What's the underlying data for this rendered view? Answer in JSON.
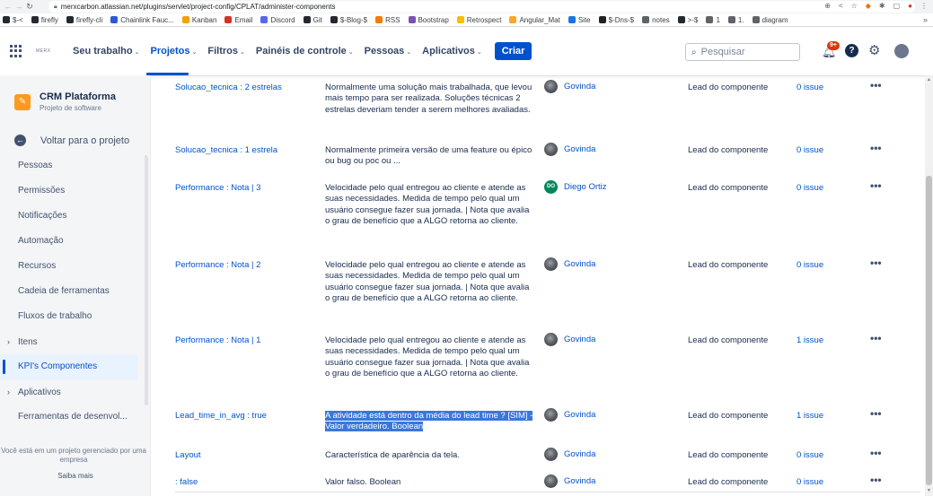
{
  "browser": {
    "url": "merxcarbon.atlassian.net/plugins/servlet/project-config/CPLAT/administer-components",
    "bookmarks": [
      {
        "label": "$-<",
        "icon": "github-icon",
        "color": "#24292f"
      },
      {
        "label": "firefly",
        "icon": "github-icon",
        "color": "#24292f"
      },
      {
        "label": "firefly-cli",
        "icon": "github-icon",
        "color": "#24292f"
      },
      {
        "label": "Chainlink Fauc...",
        "icon": "chainlink-icon",
        "color": "#2a5ada"
      },
      {
        "label": "Kanban",
        "icon": "kanban-icon",
        "color": "#f2a100"
      },
      {
        "label": "Email",
        "icon": "gmail-icon",
        "color": "#d93025"
      },
      {
        "label": "Discord",
        "icon": "discord-icon",
        "color": "#5865f2"
      },
      {
        "label": "Git",
        "icon": "github-icon",
        "color": "#24292f"
      },
      {
        "label": "$-Blog-$",
        "icon": "github-icon",
        "color": "#24292f"
      },
      {
        "label": "RSS",
        "icon": "rss-icon",
        "color": "#f57c00"
      },
      {
        "label": "Bootstrap",
        "icon": "bootstrap-icon",
        "color": "#7952b3"
      },
      {
        "label": "Retrospect",
        "icon": "retrospect-icon",
        "color": "#fbbc04"
      },
      {
        "label": "Angular_Mat",
        "icon": "angular-icon",
        "color": "#f9a825"
      },
      {
        "label": "Site",
        "icon": "drive-icon",
        "color": "#1a73e8"
      },
      {
        "label": "$-Dns-$",
        "icon": "dns-icon",
        "color": "#202124"
      },
      {
        "label": "notes",
        "icon": "folder-icon",
        "color": "#5f6368"
      },
      {
        "label": ">-$",
        "icon": "github-icon",
        "color": "#24292f"
      },
      {
        "label": "1",
        "icon": "folder-icon",
        "color": "#5f6368"
      },
      {
        "label": "1.",
        "icon": "folder-icon",
        "color": "#5f6368"
      },
      {
        "label": "diagram",
        "icon": "folder-icon",
        "color": "#5f6368"
      }
    ],
    "more": "»"
  },
  "topnav": {
    "logo_text": "MERX",
    "items": [
      {
        "label": "Seu trabalho",
        "active": false
      },
      {
        "label": "Projetos",
        "active": true
      },
      {
        "label": "Filtros",
        "active": false
      },
      {
        "label": "Painéis de controle",
        "active": false
      },
      {
        "label": "Pessoas",
        "active": false
      },
      {
        "label": "Aplicativos",
        "active": false
      }
    ],
    "create": "Criar",
    "search_placeholder": "Pesquisar",
    "notifications_badge": "9+"
  },
  "sidebar": {
    "project_name": "CRM Plataforma",
    "project_type": "Projeto de software",
    "back": "Voltar para o projeto",
    "items": [
      {
        "label": "Pessoas",
        "expandable": false,
        "selected": false
      },
      {
        "label": "Permissões",
        "expandable": false,
        "selected": false
      },
      {
        "label": "Notificações",
        "expandable": false,
        "selected": false
      },
      {
        "label": "Automação",
        "expandable": false,
        "selected": false
      },
      {
        "label": "Recursos",
        "expandable": false,
        "selected": false
      },
      {
        "label": "Cadeia de ferramentas",
        "expandable": false,
        "selected": false
      },
      {
        "label": "Fluxos de trabalho",
        "expandable": false,
        "selected": false
      },
      {
        "label": "Itens",
        "expandable": true,
        "selected": false
      },
      {
        "label": "KPI's Componentes",
        "expandable": false,
        "selected": true
      },
      {
        "label": "Aplicativos",
        "expandable": true,
        "selected": false
      },
      {
        "label": "Ferramentas de desenvol...",
        "expandable": false,
        "selected": false
      }
    ],
    "managed_note": "Você está em um projeto gerenciado por uma empresa",
    "learn_more": "Saiba mais"
  },
  "components": [
    {
      "name": "Solucao_tecnica : 2 estrelas",
      "description": "Normalmente uma solução mais trabalhada, que levou mais tempo para ser realizada. Soluções técnicas 2 estrelas deveriam tender a serem melhores avaliadas.",
      "lead": "Govinda",
      "lead_avatar": "photo",
      "assignee": "Lead do componente",
      "issues": "0 issue",
      "highlight": false
    },
    {
      "name": "Solucao_tecnica : 1 estrela",
      "description": "Normalmente primeira versão de uma feature ou épico ou bug ou poc ou ...",
      "lead": "Govinda",
      "lead_avatar": "photo",
      "assignee": "Lead do componente",
      "issues": "0 issue",
      "highlight": false
    },
    {
      "name": "Performance : Nota | 3",
      "description": "Velocidade pelo qual entregou ao cliente e atende as suas necessidades. Medida de tempo pelo qual um usuário consegue fazer sua jornada. | Nota que avalia o grau de benefício que a ALGO retorna ao cliente.",
      "lead": "Diego Ortiz",
      "lead_avatar": "DO",
      "assignee": "Lead do componente",
      "issues": "0 issue",
      "highlight": false
    },
    {
      "name": "Performance : Nota | 2",
      "description": "Velocidade pelo qual entregou ao cliente e atende as suas necessidades. Medida de tempo pelo qual um usuário consegue fazer sua jornada. | Nota que avalia o grau de benefício que a ALGO retorna ao cliente.",
      "lead": "Govinda",
      "lead_avatar": "photo",
      "assignee": "Lead do componente",
      "issues": "0 issue",
      "highlight": false
    },
    {
      "name": "Performance : Nota | 1",
      "description": "Velocidade pelo qual entregou ao cliente e atende as suas necessidades. Medida de tempo pelo qual um usuário consegue fazer sua jornada. | Nota que avalia o grau de benefício que a ALGO retorna ao cliente.",
      "lead": "Govinda",
      "lead_avatar": "photo",
      "assignee": "Lead do componente",
      "issues": "1 issue",
      "highlight": false
    },
    {
      "name": "Lead_time_in_avg : true",
      "description": "A atividade está dentro da média do lead time ? [SIM] - Valor verdadeiro. Boolean",
      "lead": "Govinda",
      "lead_avatar": "photo",
      "assignee": "Lead do componente",
      "issues": "1 issue",
      "highlight": true
    },
    {
      "name": "Layout",
      "description": "Característica de aparência da tela.",
      "lead": "Govinda",
      "lead_avatar": "photo",
      "assignee": "Lead do componente",
      "issues": "0 issue",
      "highlight": false
    },
    {
      "name": ": false",
      "description": "Valor falso. Boolean",
      "lead": "Govinda",
      "lead_avatar": "photo",
      "assignee": "Lead do componente",
      "issues": "0 issue",
      "highlight": false
    }
  ],
  "more_actions_label": "•••"
}
